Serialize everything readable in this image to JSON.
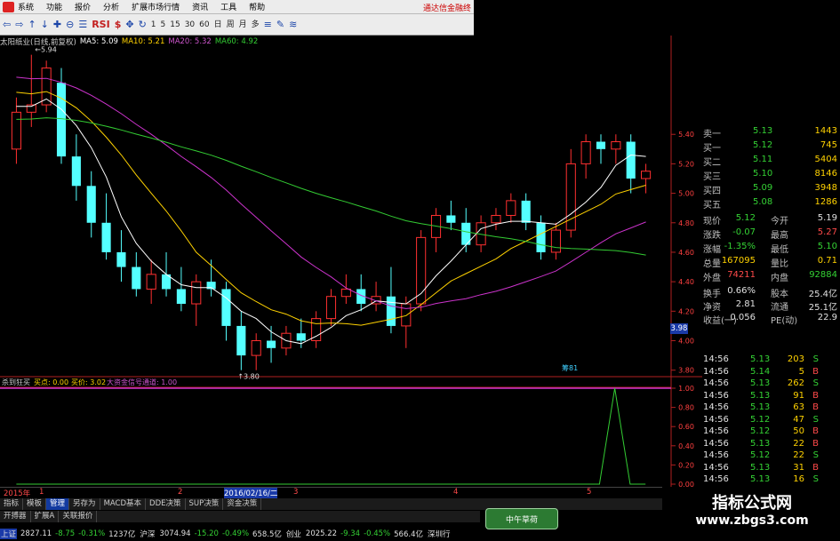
{
  "menu": {
    "items": [
      "系统",
      "功能",
      "报价",
      "分析",
      "扩展市场行情",
      "资讯",
      "工具",
      "帮助"
    ],
    "broker": "通达信金融终"
  },
  "toolbar": {
    "buttons": [
      "⇦",
      "⇨",
      "↑",
      "↓",
      "✚",
      "⊖",
      "☰",
      "RSI",
      "$",
      "✥",
      "↻",
      "1",
      "5",
      "15",
      "30",
      "60",
      "日",
      "周",
      "月",
      "多",
      "≡",
      "✎",
      "≋"
    ]
  },
  "info": {
    "title": "太阳纸业(日线,前复权)",
    "ma5": "MA5: 5.09",
    "ma10": "MA10: 5.21",
    "ma20": "MA20: 5.32",
    "ma60": "MA60: 4.92"
  },
  "chart_data": {
    "type": "candlestick",
    "high_label": "5.94",
    "low_label": "3.80",
    "y_ticks": [
      "5.40",
      "5.20",
      "5.00",
      "4.80",
      "4.60",
      "4.40",
      "4.20",
      "4.00",
      "3.80"
    ],
    "current_price": "3.98",
    "annotation": "筹81",
    "indicator": {
      "title": "杀到狂买",
      "buy_label": "买点: 0.00",
      "buy_price": "买价: 3.02",
      "signal": "大资金信号通道: 1.00",
      "y_ticks": [
        "1.00",
        "0.80",
        "0.60",
        "0.40",
        "0.20",
        "0.00"
      ],
      "signal_series": [
        0,
        0,
        0,
        0,
        0,
        0,
        0,
        0,
        0,
        0,
        0,
        0,
        0,
        0,
        0,
        0,
        0,
        0,
        0,
        0,
        0,
        0,
        0,
        0,
        0,
        0,
        0,
        0,
        0,
        0,
        0,
        0,
        0,
        0,
        0,
        0,
        0,
        0,
        0,
        1,
        0,
        0
      ]
    },
    "x_labels": [
      "2015年",
      "1",
      "2",
      "2016/02/16/二",
      "3",
      "4",
      "5"
    ],
    "candles": [
      {
        "o": 5.3,
        "h": 5.65,
        "l": 5.2,
        "c": 5.55
      },
      {
        "o": 5.55,
        "h": 5.94,
        "l": 5.45,
        "c": 5.6
      },
      {
        "o": 5.6,
        "h": 5.9,
        "l": 5.55,
        "c": 5.85
      },
      {
        "o": 5.75,
        "h": 5.85,
        "l": 5.2,
        "c": 5.25
      },
      {
        "o": 5.25,
        "h": 5.4,
        "l": 4.95,
        "c": 5.05
      },
      {
        "o": 5.05,
        "h": 5.15,
        "l": 4.7,
        "c": 4.8
      },
      {
        "o": 4.8,
        "h": 5.0,
        "l": 4.55,
        "c": 4.6
      },
      {
        "o": 4.6,
        "h": 4.75,
        "l": 4.4,
        "c": 4.5
      },
      {
        "o": 4.5,
        "h": 4.6,
        "l": 4.3,
        "c": 4.35
      },
      {
        "o": 4.35,
        "h": 4.55,
        "l": 4.25,
        "c": 4.45
      },
      {
        "o": 4.45,
        "h": 4.6,
        "l": 4.3,
        "c": 4.35
      },
      {
        "o": 4.35,
        "h": 4.5,
        "l": 4.2,
        "c": 4.25
      },
      {
        "o": 4.25,
        "h": 4.45,
        "l": 4.1,
        "c": 4.4
      },
      {
        "o": 4.4,
        "h": 4.55,
        "l": 4.3,
        "c": 4.35
      },
      {
        "o": 4.35,
        "h": 4.4,
        "l": 4.0,
        "c": 4.1
      },
      {
        "o": 4.1,
        "h": 4.2,
        "l": 3.8,
        "c": 3.9
      },
      {
        "o": 3.9,
        "h": 4.05,
        "l": 3.8,
        "c": 4.0
      },
      {
        "o": 4.0,
        "h": 4.1,
        "l": 3.85,
        "c": 3.95
      },
      {
        "o": 3.95,
        "h": 4.1,
        "l": 3.9,
        "c": 4.05
      },
      {
        "o": 4.05,
        "h": 4.15,
        "l": 3.95,
        "c": 4.0
      },
      {
        "o": 4.0,
        "h": 4.2,
        "l": 3.95,
        "c": 4.15
      },
      {
        "o": 4.15,
        "h": 4.35,
        "l": 4.1,
        "c": 4.3
      },
      {
        "o": 4.3,
        "h": 4.45,
        "l": 4.25,
        "c": 4.35
      },
      {
        "o": 4.35,
        "h": 4.45,
        "l": 4.2,
        "c": 4.25
      },
      {
        "o": 4.25,
        "h": 4.4,
        "l": 4.2,
        "c": 4.3
      },
      {
        "o": 4.3,
        "h": 4.5,
        "l": 4.05,
        "c": 4.1
      },
      {
        "o": 4.1,
        "h": 4.3,
        "l": 3.95,
        "c": 4.25
      },
      {
        "o": 4.25,
        "h": 4.75,
        "l": 4.2,
        "c": 4.7
      },
      {
        "o": 4.7,
        "h": 4.9,
        "l": 4.6,
        "c": 4.85
      },
      {
        "o": 4.85,
        "h": 4.95,
        "l": 4.75,
        "c": 4.8
      },
      {
        "o": 4.8,
        "h": 4.9,
        "l": 4.6,
        "c": 4.65
      },
      {
        "o": 4.65,
        "h": 4.85,
        "l": 4.6,
        "c": 4.8
      },
      {
        "o": 4.8,
        "h": 4.9,
        "l": 4.75,
        "c": 4.85
      },
      {
        "o": 4.85,
        "h": 5.0,
        "l": 4.8,
        "c": 4.95
      },
      {
        "o": 4.95,
        "h": 5.0,
        "l": 4.75,
        "c": 4.8
      },
      {
        "o": 4.8,
        "h": 4.85,
        "l": 4.55,
        "c": 4.6
      },
      {
        "o": 4.6,
        "h": 4.8,
        "l": 4.55,
        "c": 4.75
      },
      {
        "o": 4.75,
        "h": 5.3,
        "l": 4.7,
        "c": 5.2
      },
      {
        "o": 5.2,
        "h": 5.4,
        "l": 5.1,
        "c": 5.35
      },
      {
        "o": 5.35,
        "h": 5.4,
        "l": 5.2,
        "c": 5.3
      },
      {
        "o": 5.3,
        "h": 5.4,
        "l": 5.2,
        "c": 5.35
      },
      {
        "o": 5.35,
        "h": 5.4,
        "l": 5.0,
        "c": 5.1
      },
      {
        "o": 5.1,
        "h": 5.2,
        "l": 5.0,
        "c": 5.15
      }
    ]
  },
  "order_book": {
    "sell": [
      {
        "label": "卖一",
        "price": "5.13",
        "vol": "1443"
      },
      {
        "label": "买一",
        "price": "5.12",
        "vol": "745"
      },
      {
        "label": "买二",
        "price": "5.11",
        "vol": "5404"
      },
      {
        "label": "买三",
        "price": "5.10",
        "vol": "8146"
      },
      {
        "label": "买四",
        "price": "5.09",
        "vol": "3948"
      },
      {
        "label": "买五",
        "price": "5.08",
        "vol": "1286"
      }
    ],
    "stats": [
      {
        "l1": "现价",
        "v1": "5.12",
        "l2": "今开",
        "v2": "5.19",
        "c1": "green",
        "c2": "white"
      },
      {
        "l1": "涨跌",
        "v1": "-0.07",
        "l2": "最高",
        "v2": "5.27",
        "c1": "green",
        "c2": "red"
      },
      {
        "l1": "涨幅",
        "v1": "-1.35%",
        "l2": "最低",
        "v2": "5.10",
        "c1": "green",
        "c2": "green"
      },
      {
        "l1": "总量",
        "v1": "167095",
        "l2": "量比",
        "v2": "0.71",
        "c1": "yellow",
        "c2": "yellow"
      },
      {
        "l1": "外盘",
        "v1": "74211",
        "l2": "内盘",
        "v2": "92884",
        "c1": "red",
        "c2": "green"
      }
    ],
    "fund": [
      {
        "l1": "换手",
        "v1": "0.66%",
        "l2": "股本",
        "v2": "25.4亿"
      },
      {
        "l1": "净资",
        "v1": "2.81",
        "l2": "流通",
        "v2": "25.1亿"
      },
      {
        "l1": "收益(一)",
        "v1": "0.056",
        "l2": "PE(动)",
        "v2": "22.9"
      }
    ]
  },
  "ticks": [
    {
      "t": "14:56",
      "p": "5.13",
      "v": "203",
      "s": "S"
    },
    {
      "t": "14:56",
      "p": "5.14",
      "v": "5",
      "s": "B"
    },
    {
      "t": "14:56",
      "p": "5.13",
      "v": "262",
      "s": "S"
    },
    {
      "t": "14:56",
      "p": "5.13",
      "v": "91",
      "s": "B"
    },
    {
      "t": "14:56",
      "p": "5.13",
      "v": "63",
      "s": "B"
    },
    {
      "t": "14:56",
      "p": "5.12",
      "v": "47",
      "s": "S"
    },
    {
      "t": "14:56",
      "p": "5.12",
      "v": "50",
      "s": "B"
    },
    {
      "t": "14:56",
      "p": "5.13",
      "v": "22",
      "s": "B"
    },
    {
      "t": "14:56",
      "p": "5.12",
      "v": "22",
      "s": "S"
    },
    {
      "t": "14:56",
      "p": "5.13",
      "v": "31",
      "s": "B"
    },
    {
      "t": "14:56",
      "p": "5.13",
      "v": "16",
      "s": "S"
    }
  ],
  "tabs": [
    "指标",
    "模板",
    "管理",
    "另存为",
    "MACD基本",
    "DDE决策",
    "SUP决策",
    "资金决策"
  ],
  "tabs_active": 2,
  "tabs2": [
    "开搏器",
    "扩展A",
    "关联报价"
  ],
  "status": [
    {
      "k": "上证",
      "v": "2827.11",
      "c": "white"
    },
    {
      "k": "",
      "v": "-8.75",
      "c": "green"
    },
    {
      "k": "",
      "v": "-0.31%",
      "c": "green"
    },
    {
      "k": "",
      "v": "1237亿",
      "c": "white"
    },
    {
      "k": "沪深",
      "v": "3074.94",
      "c": "white"
    },
    {
      "k": "",
      "v": "-15.20",
      "c": "green"
    },
    {
      "k": "",
      "v": "-0.49%",
      "c": "green"
    },
    {
      "k": "",
      "v": "658.5亿",
      "c": "white"
    },
    {
      "k": "创业",
      "v": "2025.22",
      "c": "white"
    },
    {
      "k": "",
      "v": "-9.34",
      "c": "green"
    },
    {
      "k": "",
      "v": "-0.45%",
      "c": "green"
    },
    {
      "k": "",
      "v": "566.4亿",
      "c": "white"
    },
    {
      "k": "深圳行",
      "v": "",
      "c": "white"
    }
  ],
  "badge": "中午草荷",
  "brand": {
    "line1": "指标公式网",
    "line2": "www.zbgs3.com"
  },
  "colors": {
    "up": "#ff3030",
    "down": "#54ffff",
    "ma5": "#ffffff",
    "ma10": "#ffd200",
    "ma20": "#cc33cc",
    "ma60": "#33cc33"
  }
}
